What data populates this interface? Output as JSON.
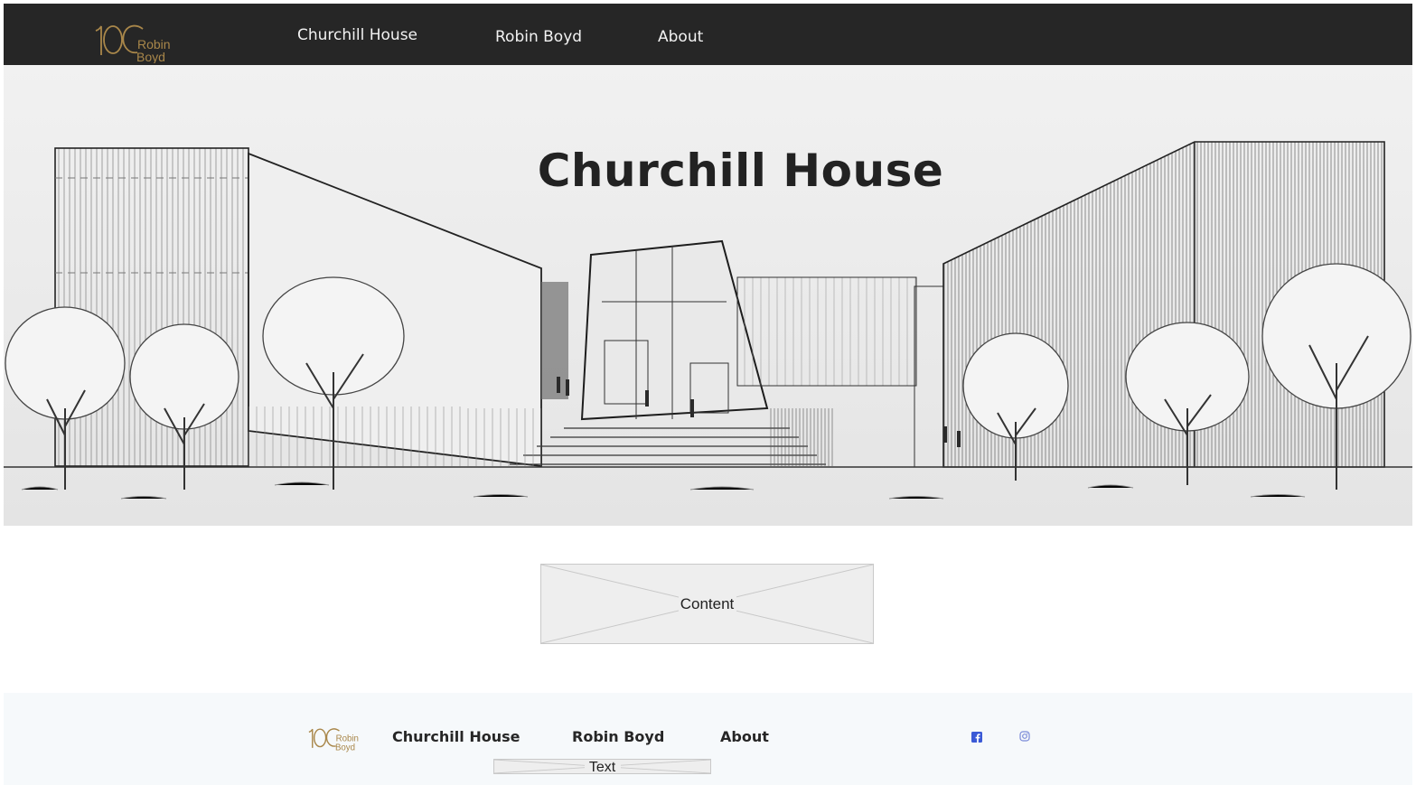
{
  "brand": {
    "logo_number": "100",
    "logo_line1": "Robin",
    "logo_line2": "Boyd",
    "accent_color": "#a9874a"
  },
  "nav": {
    "items": [
      {
        "label": "Churchill House"
      },
      {
        "label": "Robin Boyd"
      },
      {
        "label": "About"
      }
    ],
    "background": "#262626"
  },
  "hero": {
    "title": "Churchill House",
    "image_icon": "architectural-sketch-image"
  },
  "content": {
    "placeholder_label": "Content"
  },
  "footer": {
    "items": [
      {
        "label": "Churchill House"
      },
      {
        "label": "Robin Boyd"
      },
      {
        "label": "About"
      }
    ],
    "text_placeholder": "Text",
    "social": [
      {
        "icon": "facebook-icon",
        "color": "#3b5ad6"
      },
      {
        "icon": "instagram-icon",
        "color": "#7a8ad8"
      }
    ],
    "background": "#f6f9fb"
  }
}
